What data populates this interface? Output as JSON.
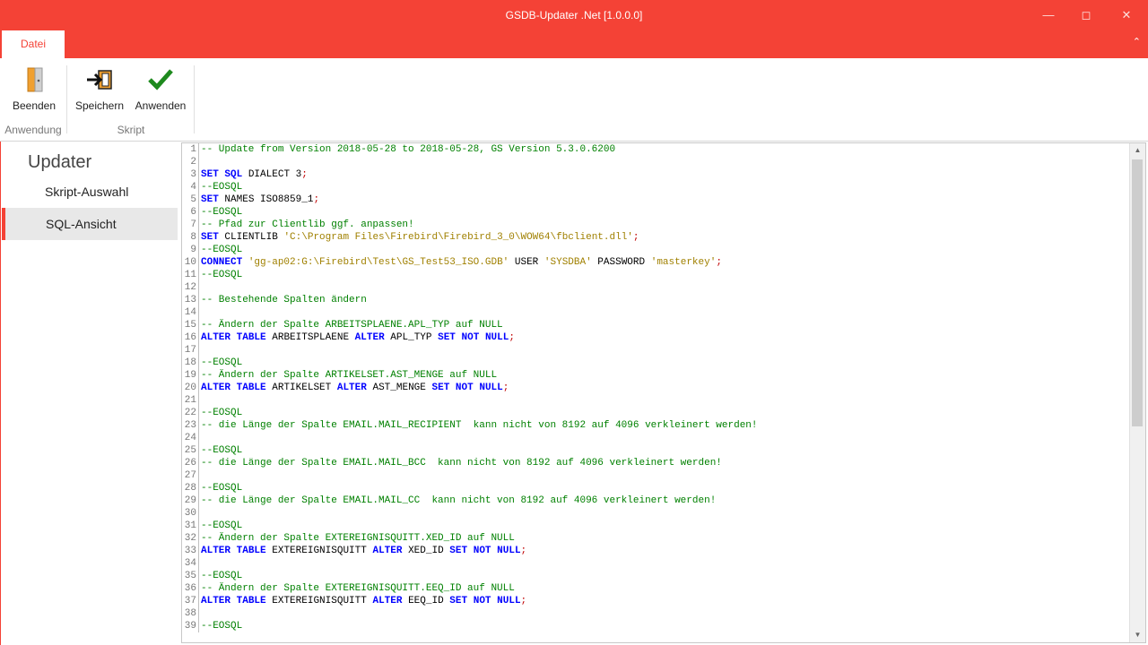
{
  "window": {
    "title": "GSDB-Updater .Net [1.0.0.0]"
  },
  "ribbon": {
    "tab": "Datei",
    "groups": [
      {
        "label": "Anwendung",
        "buttons": [
          {
            "label": "Beenden",
            "icon": "exit-door-icon"
          }
        ]
      },
      {
        "label": "Skript",
        "buttons": [
          {
            "label": "Speichern",
            "icon": "save-arrow-icon"
          },
          {
            "label": "Anwenden",
            "icon": "checkmark-icon"
          }
        ]
      }
    ]
  },
  "sidebar": {
    "title": "Updater",
    "items": [
      {
        "label": "Skript-Auswahl"
      },
      {
        "label": "SQL-Ansicht",
        "active": true
      }
    ]
  },
  "colors": {
    "accent": "#f44236",
    "comment": "#008000",
    "keyword": "#0000ff",
    "string": "#a08000"
  },
  "editor": {
    "lines": [
      [
        [
          "-- Update from Version 2018-05-28 to 2018-05-28, GS Version 5.3.0.6200",
          "c"
        ]
      ],
      [],
      [
        [
          "SET",
          "k"
        ],
        [
          " ",
          ""
        ],
        [
          "SQL",
          "k"
        ],
        [
          " DIALECT 3",
          ""
        ],
        [
          ";",
          "p"
        ]
      ],
      [
        [
          "--EOSQL",
          "c"
        ]
      ],
      [
        [
          "SET",
          "k"
        ],
        [
          " NAMES ISO8859_1",
          ""
        ],
        [
          ";",
          "p"
        ]
      ],
      [
        [
          "--EOSQL",
          "c"
        ]
      ],
      [
        [
          "-- Pfad zur Clientlib ggf. anpassen!",
          "c"
        ]
      ],
      [
        [
          "SET",
          "k"
        ],
        [
          " CLIENTLIB ",
          ""
        ],
        [
          "'C:\\Program Files\\Firebird\\Firebird_3_0\\WOW64\\fbclient.dll'",
          "s"
        ],
        [
          ";",
          "p"
        ]
      ],
      [
        [
          "--EOSQL",
          "c"
        ]
      ],
      [
        [
          "CONNECT",
          "k"
        ],
        [
          " ",
          ""
        ],
        [
          "'gg-ap02:G:\\Firebird\\Test\\GS_Test53_ISO.GDB'",
          "s"
        ],
        [
          " USER ",
          ""
        ],
        [
          "'SYSDBA'",
          "s"
        ],
        [
          " PASSWORD ",
          ""
        ],
        [
          "'masterkey'",
          "s"
        ],
        [
          ";",
          "p"
        ]
      ],
      [
        [
          "--EOSQL",
          "c"
        ]
      ],
      [],
      [
        [
          "-- Bestehende Spalten ändern",
          "c"
        ]
      ],
      [],
      [
        [
          "-- Ändern der Spalte ARBEITSPLAENE.APL_TYP auf NULL",
          "c"
        ]
      ],
      [
        [
          "ALTER",
          "k"
        ],
        [
          " ",
          ""
        ],
        [
          "TABLE",
          "k"
        ],
        [
          " ARBEITSPLAENE ",
          ""
        ],
        [
          "ALTER",
          "k"
        ],
        [
          " APL_TYP ",
          ""
        ],
        [
          "SET",
          "k"
        ],
        [
          " ",
          ""
        ],
        [
          "NOT",
          "k"
        ],
        [
          " ",
          ""
        ],
        [
          "NULL",
          "k"
        ],
        [
          ";",
          "p"
        ]
      ],
      [],
      [
        [
          "--EOSQL",
          "c"
        ]
      ],
      [
        [
          "-- Ändern der Spalte ARTIKELSET.AST_MENGE auf NULL",
          "c"
        ]
      ],
      [
        [
          "ALTER",
          "k"
        ],
        [
          " ",
          ""
        ],
        [
          "TABLE",
          "k"
        ],
        [
          " ARTIKELSET ",
          ""
        ],
        [
          "ALTER",
          "k"
        ],
        [
          " AST_MENGE ",
          ""
        ],
        [
          "SET",
          "k"
        ],
        [
          " ",
          ""
        ],
        [
          "NOT",
          "k"
        ],
        [
          " ",
          ""
        ],
        [
          "NULL",
          "k"
        ],
        [
          ";",
          "p"
        ]
      ],
      [],
      [
        [
          "--EOSQL",
          "c"
        ]
      ],
      [
        [
          "-- die Länge der Spalte EMAIL.MAIL_RECIPIENT  kann nicht von 8192 auf 4096 verkleinert werden!",
          "c"
        ]
      ],
      [],
      [
        [
          "--EOSQL",
          "c"
        ]
      ],
      [
        [
          "-- die Länge der Spalte EMAIL.MAIL_BCC  kann nicht von 8192 auf 4096 verkleinert werden!",
          "c"
        ]
      ],
      [],
      [
        [
          "--EOSQL",
          "c"
        ]
      ],
      [
        [
          "-- die Länge der Spalte EMAIL.MAIL_CC  kann nicht von 8192 auf 4096 verkleinert werden!",
          "c"
        ]
      ],
      [],
      [
        [
          "--EOSQL",
          "c"
        ]
      ],
      [
        [
          "-- Ändern der Spalte EXTEREIGNISQUITT.XED_ID auf NULL",
          "c"
        ]
      ],
      [
        [
          "ALTER",
          "k"
        ],
        [
          " ",
          ""
        ],
        [
          "TABLE",
          "k"
        ],
        [
          " EXTEREIGNISQUITT ",
          ""
        ],
        [
          "ALTER",
          "k"
        ],
        [
          " XED_ID ",
          ""
        ],
        [
          "SET",
          "k"
        ],
        [
          " ",
          ""
        ],
        [
          "NOT",
          "k"
        ],
        [
          " ",
          ""
        ],
        [
          "NULL",
          "k"
        ],
        [
          ";",
          "p"
        ]
      ],
      [],
      [
        [
          "--EOSQL",
          "c"
        ]
      ],
      [
        [
          "-- Ändern der Spalte EXTEREIGNISQUITT.EEQ_ID auf NULL",
          "c"
        ]
      ],
      [
        [
          "ALTER",
          "k"
        ],
        [
          " ",
          ""
        ],
        [
          "TABLE",
          "k"
        ],
        [
          " EXTEREIGNISQUITT ",
          ""
        ],
        [
          "ALTER",
          "k"
        ],
        [
          " EEQ_ID ",
          ""
        ],
        [
          "SET",
          "k"
        ],
        [
          " ",
          ""
        ],
        [
          "NOT",
          "k"
        ],
        [
          " ",
          ""
        ],
        [
          "NULL",
          "k"
        ],
        [
          ";",
          "p"
        ]
      ],
      [],
      [
        [
          "--EOSQL",
          "c"
        ]
      ]
    ]
  }
}
